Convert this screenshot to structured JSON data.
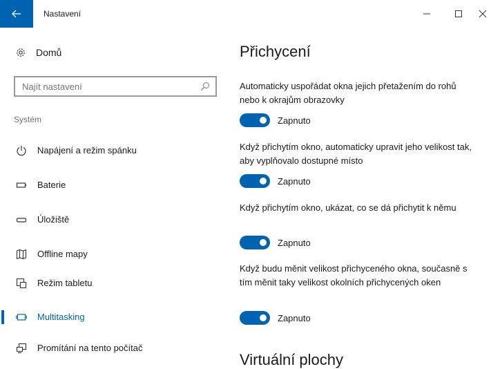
{
  "window": {
    "title": "Nastavení",
    "accent": "#0063b1"
  },
  "sidebar": {
    "home_label": "Domů",
    "search": {
      "placeholder": "Najít nastavení"
    },
    "group_label": "Systém",
    "items": [
      {
        "label": "Napájení a režim spánku",
        "icon": "power-icon",
        "selected": false
      },
      {
        "label": "Baterie",
        "icon": "battery-icon",
        "selected": false
      },
      {
        "label": "Úložiště",
        "icon": "storage-icon",
        "selected": false
      },
      {
        "label": "Offline mapy",
        "icon": "map-icon",
        "selected": false
      },
      {
        "label": "Režim tabletu",
        "icon": "tablet-mode-icon",
        "selected": false
      },
      {
        "label": "Multitasking",
        "icon": "multitasking-icon",
        "selected": true
      },
      {
        "label": "Promítání na tento počítač",
        "icon": "project-icon",
        "selected": false
      }
    ]
  },
  "main": {
    "heading": "Přichycení",
    "settings": [
      {
        "description": "Automaticky uspořádat okna jejich přetažením do rohů nebo k okrajům obrazovky",
        "state": "Zapnuto",
        "on": true
      },
      {
        "description": "Když přichytím okno, automaticky upravit jeho velikost tak, aby vyplňovalo dostupné místo",
        "state": "Zapnuto",
        "on": true
      },
      {
        "description": "Když přichytím okno, ukázat, co se dá přichytit k němu",
        "state": "Zapnuto",
        "on": true
      },
      {
        "description": "Když budu měnit velikost přichyceného okna, současně s tím měnit taky velikost okolních přichycených oken",
        "state": "Zapnuto",
        "on": true
      }
    ],
    "section2_heading": "Virtuální plochy"
  }
}
